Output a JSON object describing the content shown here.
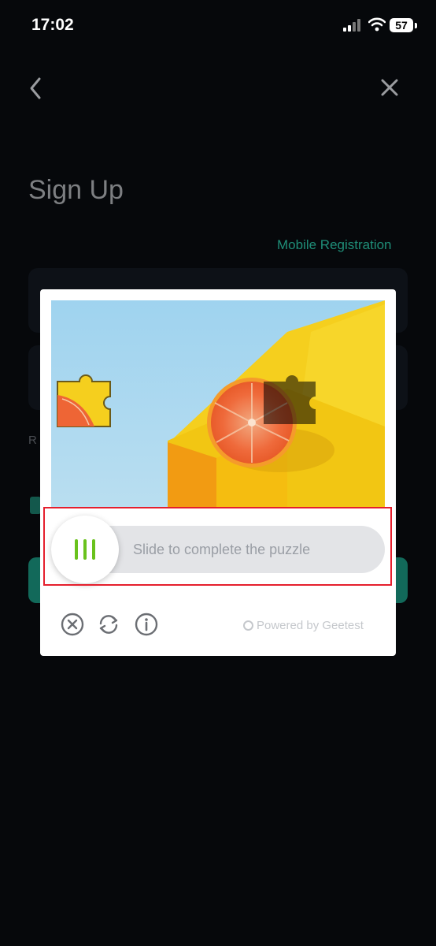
{
  "status_bar": {
    "time": "17:02",
    "battery": "57",
    "icons": [
      "signal-icon",
      "wifi-icon",
      "battery-icon"
    ]
  },
  "nav": {
    "back_icon": "chevron-left-icon",
    "close_icon": "close-icon"
  },
  "page": {
    "title": "Sign Up",
    "mobile_registration_link": "Mobile Registration",
    "partial_letter": "R"
  },
  "captcha": {
    "slider_instruction": "Slide to complete the puzzle",
    "handle_icon": "grip-lines-icon",
    "footer_icons": [
      "close-circle-icon",
      "refresh-icon",
      "info-icon"
    ],
    "powered_by": "Powered by Geetest"
  },
  "colors": {
    "accent": "#1f8e78",
    "highlight": "#e51f2d",
    "handle_green": "#69c21c",
    "background": "#06080b"
  }
}
